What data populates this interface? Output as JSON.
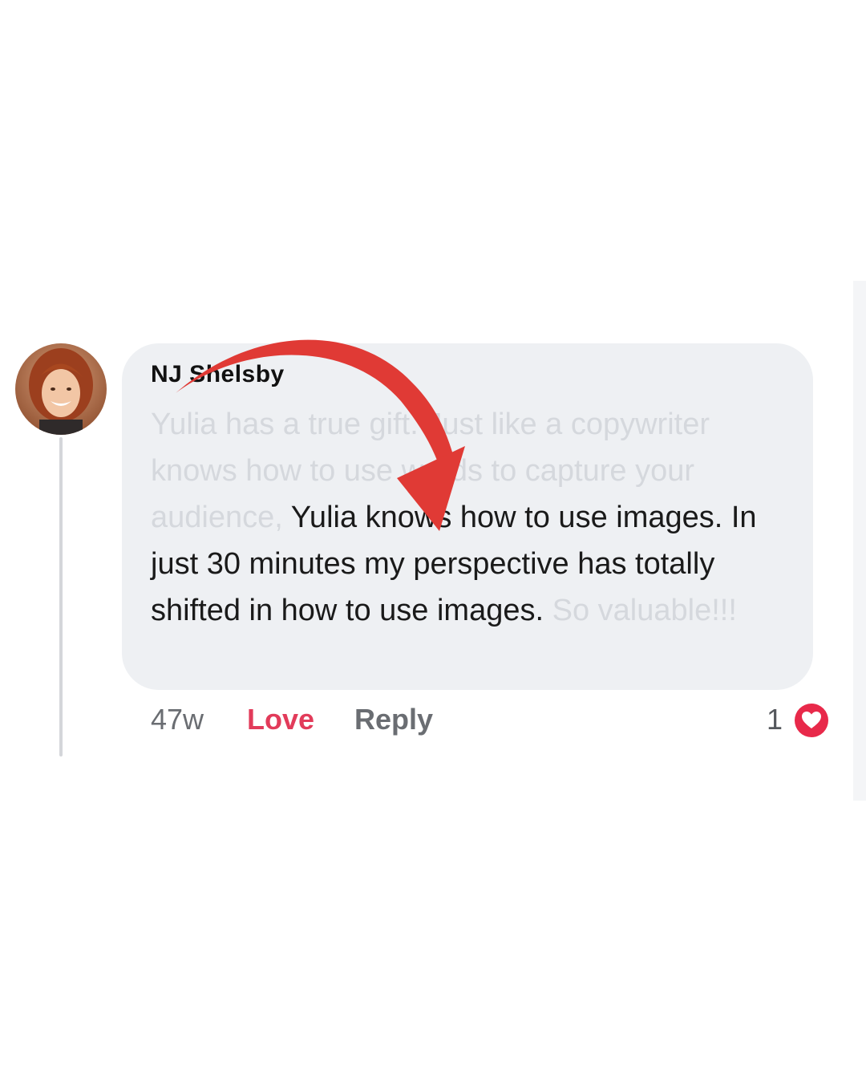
{
  "comment": {
    "author": "NJ Shelsby",
    "text_faded_start": "Yulia has a true gift. Just like a copywriter knows how to use words to capture your audience, ",
    "text_highlight": "Yulia knows how to use images. In just 30 minutes my perspective has totally shifted in how to use images.",
    "text_faded_end": " So valuable!!!",
    "timestamp": "47w",
    "reaction_label": "Love",
    "reply_label": "Reply",
    "reaction_count": "1",
    "reaction_icon": "heart-icon"
  },
  "colors": {
    "bubble": "#eef0f3",
    "love": "#e23b5a",
    "arrow": "#e03a35",
    "faded_text": "#d5d8dd"
  }
}
